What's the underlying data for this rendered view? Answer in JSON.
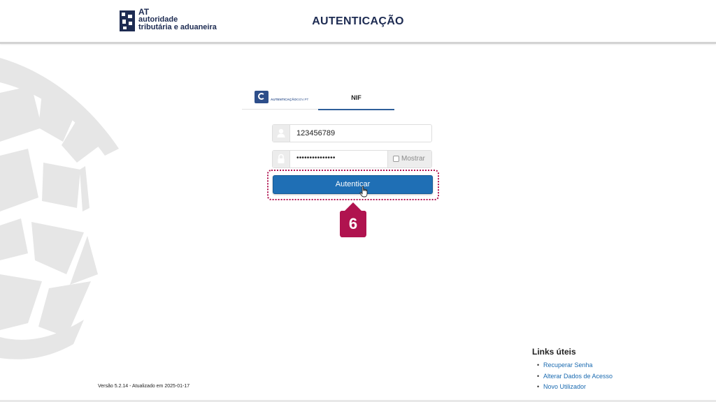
{
  "header": {
    "logo": {
      "line1": "AT",
      "line2": "autoridade",
      "line3": "tributária e aduaneira"
    },
    "title": "AUTENTICAÇÃO"
  },
  "tabs": [
    {
      "label": "AUTENTICAÇÃO",
      "label_suffix": "GOV.PT",
      "icon": "cmd-logo-icon",
      "active": false
    },
    {
      "label": "NIF",
      "active": true
    }
  ],
  "form": {
    "username": {
      "value": "123456789",
      "icon": "user-icon"
    },
    "password": {
      "value": "•••••••••••••••",
      "icon": "lock-icon"
    },
    "show_label": "Mostrar",
    "submit_label": "Autenticar"
  },
  "annotation": {
    "step": "6",
    "color": "#b0134f"
  },
  "footer": {
    "version": "Versão 5.2.14 - Atualizado em 2025-01-17",
    "links_title": "Links úteis",
    "links": [
      "Recuperar Senha",
      "Alterar Dados de Acesso",
      "Novo Utilizador"
    ]
  },
  "colors": {
    "primary": "#1f6fb5",
    "header_text": "#1d2b52",
    "link": "#1a6ab0",
    "accent": "#b0134f"
  }
}
